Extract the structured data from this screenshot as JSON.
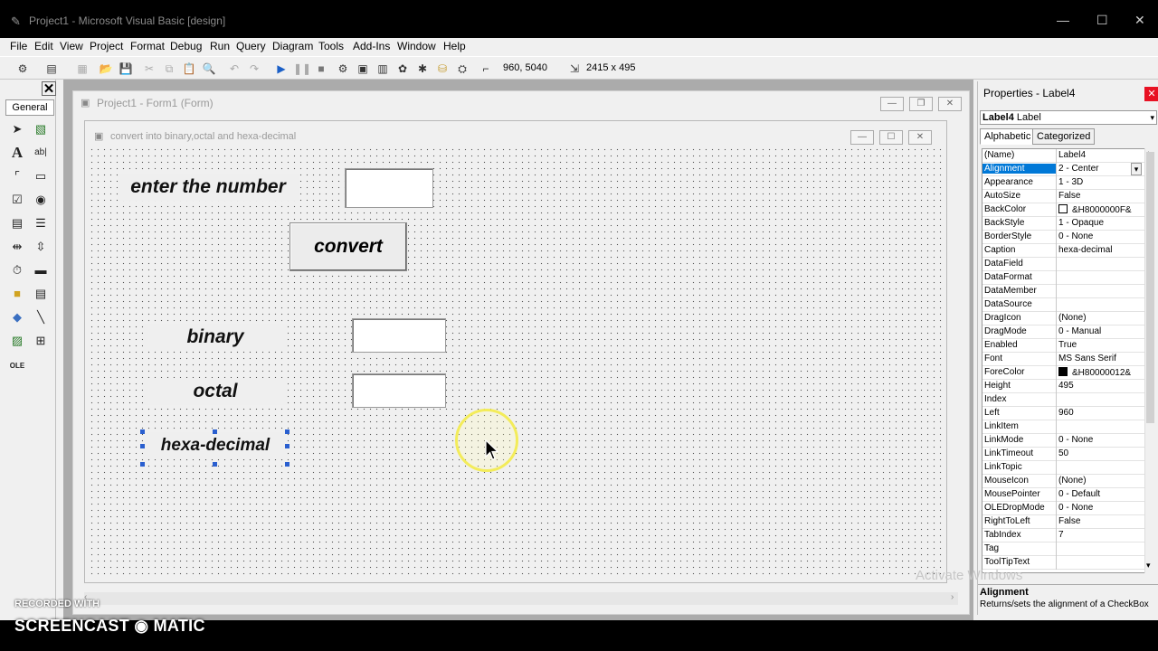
{
  "app": {
    "title": "Project1 - Microsoft Visual Basic [design]",
    "icon": "vb-app-icon"
  },
  "menu": [
    "File",
    "Edit",
    "View",
    "Project",
    "Format",
    "Debug",
    "Run",
    "Query",
    "Diagram",
    "Tools",
    "Add-Ins",
    "Window",
    "Help"
  ],
  "toolbar": {
    "position": "960, 5040",
    "size": "2415 x 495"
  },
  "toolbox": {
    "tab": "General",
    "tools": [
      "pointer-icon",
      "picture-box-icon",
      "label-icon",
      "text-box-icon",
      "frame-icon",
      "command-button-icon",
      "checkbox-icon",
      "option-button-icon",
      "combo-box-icon",
      "list-box-icon",
      "hscroll-icon",
      "vscroll-icon",
      "timer-icon",
      "drive-list-icon",
      "dir-list-icon",
      "file-list-icon",
      "shape-icon",
      "line-icon",
      "image-icon",
      "data-icon",
      "ole-icon"
    ],
    "label_glyph": "A",
    "textbox_glyph": "ab|"
  },
  "project_window": {
    "title": "Project1 - Form1 (Form)"
  },
  "form": {
    "caption": "convert into binary,octal and hexa-decimal",
    "labels": {
      "enter": "enter the number",
      "binary": "binary",
      "octal": "octal",
      "hex": "hexa-decimal"
    },
    "button": "convert"
  },
  "properties": {
    "title": "Properties - Label4",
    "object_name": "Label4",
    "object_type": "Label",
    "tabs": [
      "Alphabetic",
      "Categorized"
    ],
    "rows": [
      {
        "name": "(Name)",
        "value": "Label4"
      },
      {
        "name": "Alignment",
        "value": "2 - Center",
        "selected": true
      },
      {
        "name": "Appearance",
        "value": "1 - 3D"
      },
      {
        "name": "AutoSize",
        "value": "False"
      },
      {
        "name": "BackColor",
        "value": "&H8000000F&",
        "swatch": "#ffffff"
      },
      {
        "name": "BackStyle",
        "value": "1 - Opaque"
      },
      {
        "name": "BorderStyle",
        "value": "0 - None"
      },
      {
        "name": "Caption",
        "value": "hexa-decimal"
      },
      {
        "name": "DataField",
        "value": ""
      },
      {
        "name": "DataFormat",
        "value": ""
      },
      {
        "name": "DataMember",
        "value": ""
      },
      {
        "name": "DataSource",
        "value": ""
      },
      {
        "name": "DragIcon",
        "value": "(None)"
      },
      {
        "name": "DragMode",
        "value": "0 - Manual"
      },
      {
        "name": "Enabled",
        "value": "True"
      },
      {
        "name": "Font",
        "value": "MS Sans Serif"
      },
      {
        "name": "ForeColor",
        "value": "&H80000012&",
        "swatch": "#000000"
      },
      {
        "name": "Height",
        "value": "495"
      },
      {
        "name": "Index",
        "value": ""
      },
      {
        "name": "Left",
        "value": "960"
      },
      {
        "name": "LinkItem",
        "value": ""
      },
      {
        "name": "LinkMode",
        "value": "0 - None"
      },
      {
        "name": "LinkTimeout",
        "value": "50"
      },
      {
        "name": "LinkTopic",
        "value": ""
      },
      {
        "name": "MouseIcon",
        "value": "(None)"
      },
      {
        "name": "MousePointer",
        "value": "0 - Default"
      },
      {
        "name": "OLEDropMode",
        "value": "0 - None"
      },
      {
        "name": "RightToLeft",
        "value": "False"
      },
      {
        "name": "TabIndex",
        "value": "7"
      },
      {
        "name": "Tag",
        "value": ""
      },
      {
        "name": "ToolTipText",
        "value": ""
      }
    ],
    "description_title": "Alignment",
    "description": "Returns/sets the alignment of a CheckBox"
  },
  "watermarks": {
    "windows": "Activate Windows",
    "recorder_top": "RECORDED WITH",
    "recorder_bottom": "SCREENCAST ◉ MATIC"
  },
  "colors": {
    "selection": "#0078d7",
    "cursor_highlight": "#f3ec5a",
    "close_red": "#e81123"
  }
}
